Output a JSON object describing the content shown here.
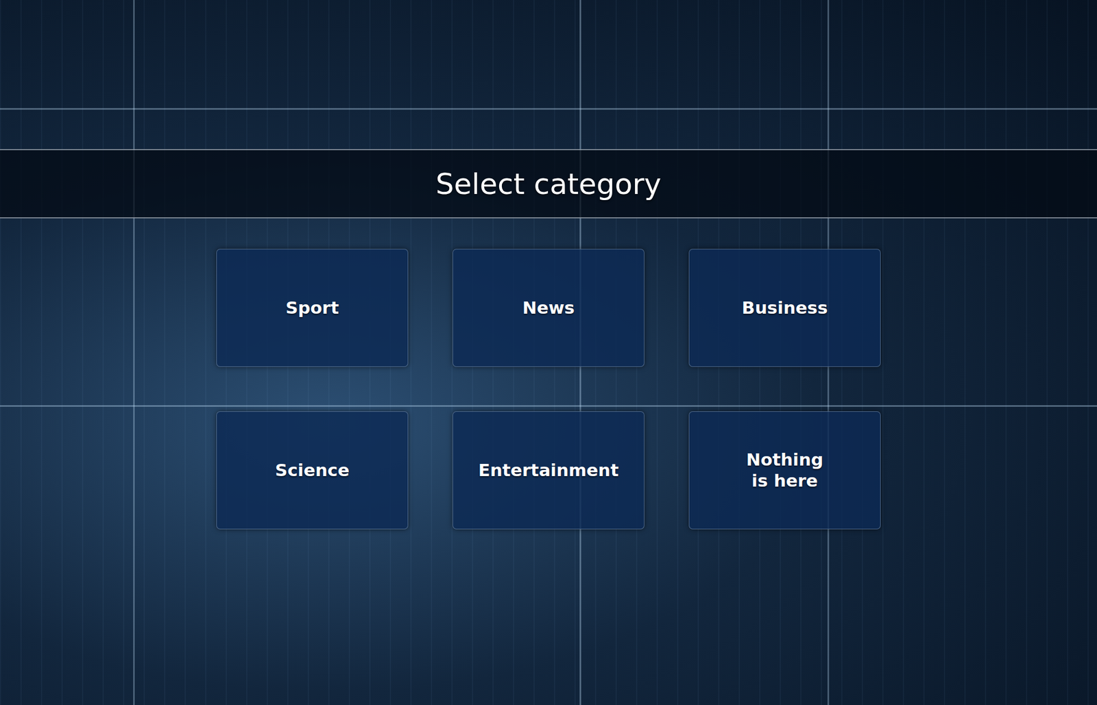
{
  "title": "Select category",
  "categories": [
    {
      "label": "Sport"
    },
    {
      "label": "News"
    },
    {
      "label": "Business"
    },
    {
      "label": "Science"
    },
    {
      "label": "Entertainment"
    },
    {
      "label": "Nothing\nis here"
    }
  ]
}
